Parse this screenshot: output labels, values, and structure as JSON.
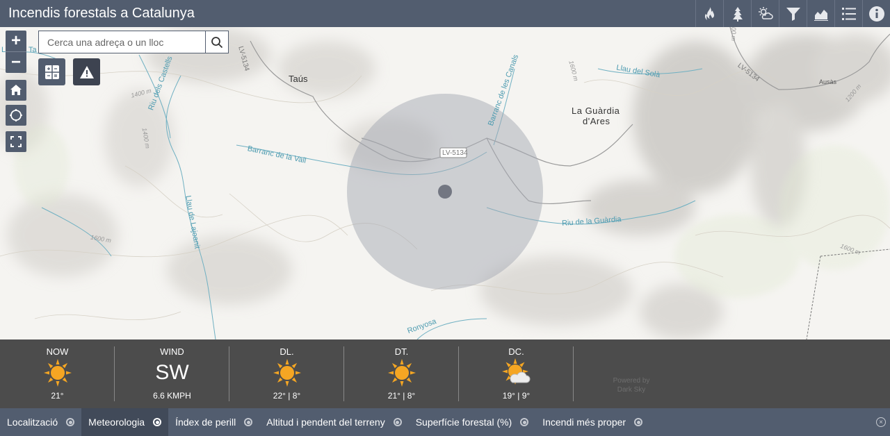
{
  "header": {
    "title": "Incendis forestals a Catalunya",
    "toolbar": [
      {
        "icon": "fire-icon"
      },
      {
        "icon": "tree-icon"
      },
      {
        "icon": "weather-icon"
      },
      {
        "icon": "filter-icon"
      },
      {
        "icon": "chart-icon"
      },
      {
        "icon": "list-icon"
      },
      {
        "icon": "info-icon"
      }
    ]
  },
  "map": {
    "search": {
      "placeholder": "Cerca una adreça o un lloc"
    },
    "zoom_in": "+",
    "zoom_out": "−",
    "place_labels": {
      "taus": "Taús",
      "guardia_1": "La Guàrdia",
      "guardia_2": "d'Ares",
      "ausas": "Ausàs"
    },
    "water_labels": {
      "castells": "Riu dels Castells",
      "vall": "Barranc de la Vall",
      "canals": "Barranc de les Canals",
      "sola": "Llau del Solà",
      "guardia": "Riu de la Guàrdia",
      "lajoanit": "Llau de Lajoanit",
      "ronyosa": "Ronyosa",
      "edge": "Llau de Ta"
    },
    "road_labels": {
      "lv5134_a": "LV-5134",
      "lv5134_b": "LV-5134",
      "lv5134_c": "LV-5134"
    },
    "contour_labels": {
      "c1": "1400 m",
      "c2": "1400 m",
      "c3": "1600 m",
      "c4": "1600 m",
      "c5": "1200 m",
      "c6": "1600 m",
      "c7": "1000 m"
    }
  },
  "weather": {
    "now": {
      "label": "NOW",
      "icon": "sun-icon",
      "temp": "21°"
    },
    "wind": {
      "label": "WIND",
      "direction": "SW",
      "speed": "6.6 KMPH"
    },
    "days": [
      {
        "label": "DL.",
        "icon": "sun-icon",
        "temp": "22° | 8°"
      },
      {
        "label": "DT.",
        "icon": "sun-icon",
        "temp": "21° | 8°"
      },
      {
        "label": "DC.",
        "icon": "partly-cloudy-icon",
        "temp": "19° | 9°"
      }
    ],
    "powered_1": "Powered by",
    "powered_2": "Dark Sky"
  },
  "tabs": [
    {
      "label": "Localització",
      "active": false
    },
    {
      "label": "Meteorologia",
      "active": true
    },
    {
      "label": "Índex de perill",
      "active": false
    },
    {
      "label": "Altitud i pendent del terreny",
      "active": false
    },
    {
      "label": "Superfície forestal (%)",
      "active": false
    },
    {
      "label": "Incendi més proper",
      "active": false
    }
  ],
  "colors": {
    "header": "#525d6f",
    "weather_bg": "#4c4c4c",
    "sun": "#f5a623",
    "water": "#4d9bb0",
    "buffer": "#c9cbd2"
  }
}
